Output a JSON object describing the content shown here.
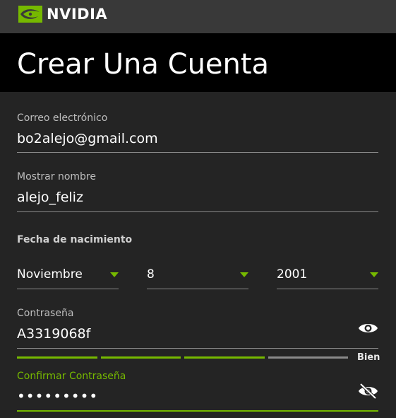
{
  "header": {
    "brand": "NVIDIA",
    "page_title": "Crear Una Cuenta"
  },
  "form": {
    "email": {
      "label": "Correo electrónico",
      "value": "bo2alejo@gmail.com"
    },
    "display_name": {
      "label": "Mostrar nombre",
      "value": "alejo_feliz"
    },
    "birthdate": {
      "label": "Fecha de nacimiento",
      "month": "Noviembre",
      "day": "8",
      "year": "2001"
    },
    "password": {
      "label": "Contraseña",
      "value": "A3319068f",
      "strength_label": "Bien",
      "strength_segments_filled": 3,
      "strength_segments_total": 4
    },
    "confirm_password": {
      "label": "Confirmar Contraseña",
      "masked_value": "•••••••••"
    }
  },
  "colors": {
    "accent": "#76b900",
    "background": "#242424",
    "header_bar": "#393939",
    "title_bar": "#000000",
    "strength_empty": "#8a8a8a"
  },
  "icons": {
    "password_toggle": "eye-icon",
    "confirm_toggle": "eye-slash-icon",
    "select_arrow": "chevron-down-icon"
  }
}
